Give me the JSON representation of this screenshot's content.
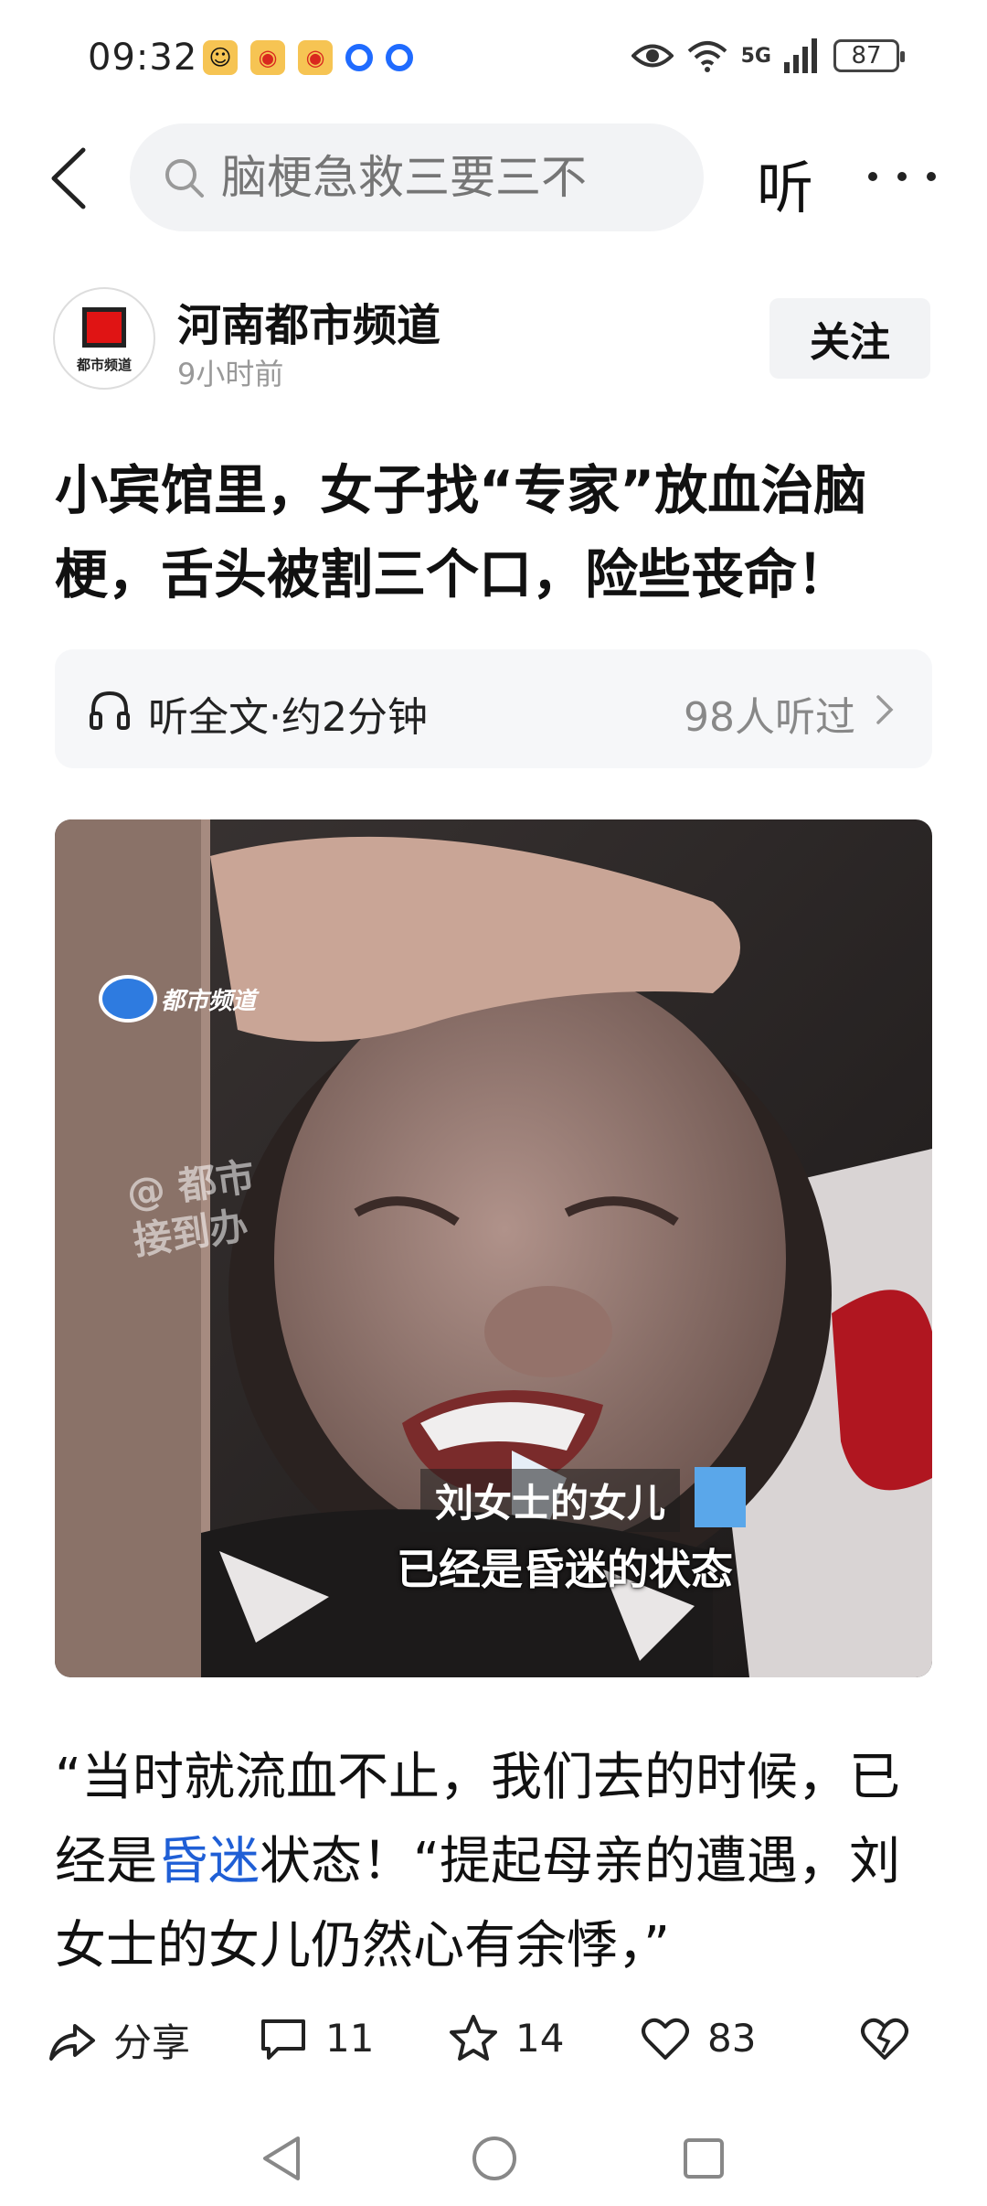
{
  "status_bar": {
    "time": "09:32",
    "network": "5G",
    "battery": "87"
  },
  "top_bar": {
    "search_placeholder": "脑梗急救三要三不",
    "listen_label": "听"
  },
  "author": {
    "name": "河南都市频道",
    "time": "9小时前",
    "avatar_text": "都市频道",
    "follow_label": "关注"
  },
  "article": {
    "title": "小宾馆里，女子找“专家”放血治脑梗，舌头被割三个口，险些丧命！",
    "listen_label": "听全文·约2分钟",
    "listen_count": "98人听过",
    "image": {
      "watermark": "都市频道",
      "watermark2": "@ 都市\n接到办",
      "subtitle_line1": "刘女士的女儿",
      "subtitle_line2": "已经是昏迷的状态"
    },
    "body_before": "“当时就流血不止，我们去的时候，已经是",
    "body_link": "昏迷",
    "body_after": "状态！“提起母亲的遭遇，刘女士的女儿仍然心有余悸，”"
  },
  "actions": {
    "share_label": "分享",
    "comments": "11",
    "favorites": "14",
    "likes": "83"
  }
}
